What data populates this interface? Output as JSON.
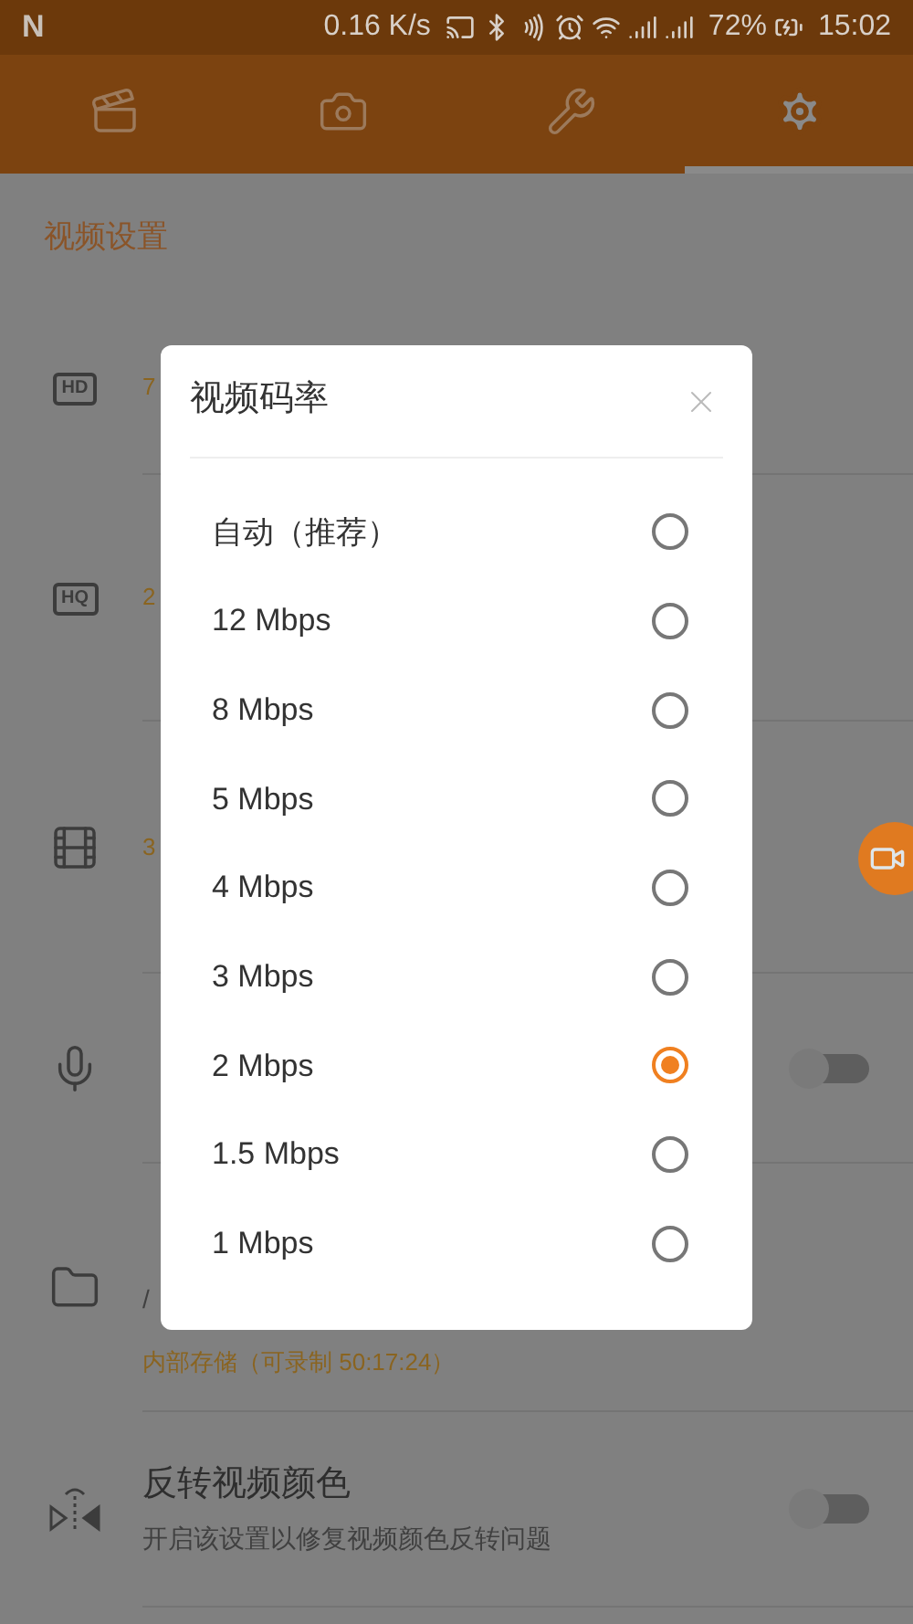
{
  "status_bar": {
    "logo": "N",
    "speed": "0.16 K/s",
    "battery": "72%",
    "time": "15:02"
  },
  "tabs": [
    {
      "selected": false
    },
    {
      "selected": false
    },
    {
      "selected": false
    },
    {
      "selected": true
    }
  ],
  "section_title": "视频设置",
  "rows": [
    {
      "icon_label": "HD",
      "kind": "value",
      "detail": "7"
    },
    {
      "icon_label": "HQ",
      "kind": "value",
      "detail": "2"
    },
    {
      "kind": "value",
      "detail": "3"
    },
    {
      "kind": "toggle",
      "on": false
    },
    {
      "kind": "value",
      "subtitle": "/",
      "detail": "内部存储（可录制 50:17:24）"
    },
    {
      "kind": "toggle",
      "title": "反转视频颜色",
      "subtitle": "开启该设置以修复视频颜色反转问题",
      "on": false
    }
  ],
  "dialog": {
    "title": "视频码率",
    "options": [
      {
        "label": "自动（推荐）",
        "selected": false
      },
      {
        "label": "12 Mbps",
        "selected": false
      },
      {
        "label": "8 Mbps",
        "selected": false
      },
      {
        "label": "5 Mbps",
        "selected": false
      },
      {
        "label": "4 Mbps",
        "selected": false
      },
      {
        "label": "3 Mbps",
        "selected": false
      },
      {
        "label": "2 Mbps",
        "selected": true
      },
      {
        "label": "1.5 Mbps",
        "selected": false
      },
      {
        "label": "1 Mbps",
        "selected": false
      }
    ]
  }
}
